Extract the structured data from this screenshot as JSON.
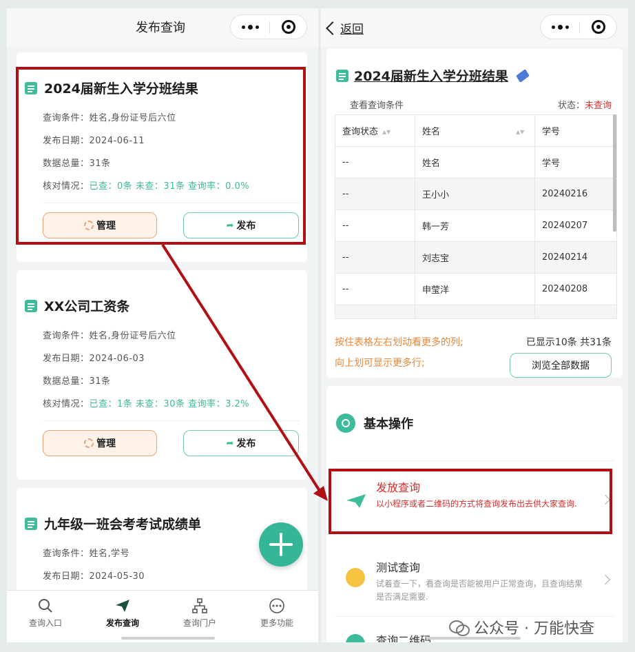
{
  "left": {
    "nav_title": "发布查询",
    "cards": [
      {
        "title": "2024届新生入学分班结果",
        "conditions": "查询条件：姓名,身份证号后六位",
        "date": "发布日期：2024-06-11",
        "total": "数据总量：31条",
        "check_label": "核对情况：",
        "check_value": "已查：0条 未查：31条 查询率：0.0%",
        "manage": "管理",
        "publish": "发布"
      },
      {
        "title": "XX公司工资条",
        "conditions": "查询条件：姓名,身份证号后六位",
        "date": "发布日期：2024-06-03",
        "total": "数据总量：31条",
        "check_label": "核对情况：",
        "check_value": "已查：1条 未查：30条 查询率：3.2%",
        "manage": "管理",
        "publish": "发布"
      },
      {
        "title": "九年级一班会考考试成绩单",
        "conditions": "查询条件：姓名,学号",
        "date": "发布日期：2024-05-30"
      }
    ],
    "tabs": [
      "查询入口",
      "发布查询",
      "查询门户",
      "更多功能"
    ]
  },
  "right": {
    "back": "返回",
    "title": "2024届新生入学分班结果",
    "view_conditions": "查看查询条件",
    "status_label": "状态：",
    "status_value": "未查询",
    "headers": [
      "查询状态",
      "姓名",
      "学号"
    ],
    "rows": [
      [
        "--",
        "姓名",
        "学号"
      ],
      [
        "--",
        "王小小",
        "20240216"
      ],
      [
        "--",
        "韩一芳",
        "20240207"
      ],
      [
        "--",
        "刘志宝",
        "20240214"
      ],
      [
        "--",
        "申莹洋",
        "20240208"
      ]
    ],
    "hint1": "按住表格左右划动看更多的列;",
    "hint2": "向上划可显示更多行;",
    "count": "已显示10条 共31条",
    "browse": "浏览全部数据",
    "section": "基本操作",
    "ops": [
      {
        "title": "发放查询",
        "desc": "以小程序或者二维码的方式将查询发布出去供大家查询."
      },
      {
        "title": "测试查询",
        "desc": "试着查一下，看查询是否能被用户正常查询，且查询结果是否满足需要."
      },
      {
        "title": "查询二维码"
      }
    ]
  },
  "watermark": "公众号 · 万能快查",
  "colors": {
    "accent": "#3dbb9a",
    "highlight": "#b10f14",
    "warn": "#e8873a",
    "status_red": "#e03030"
  }
}
